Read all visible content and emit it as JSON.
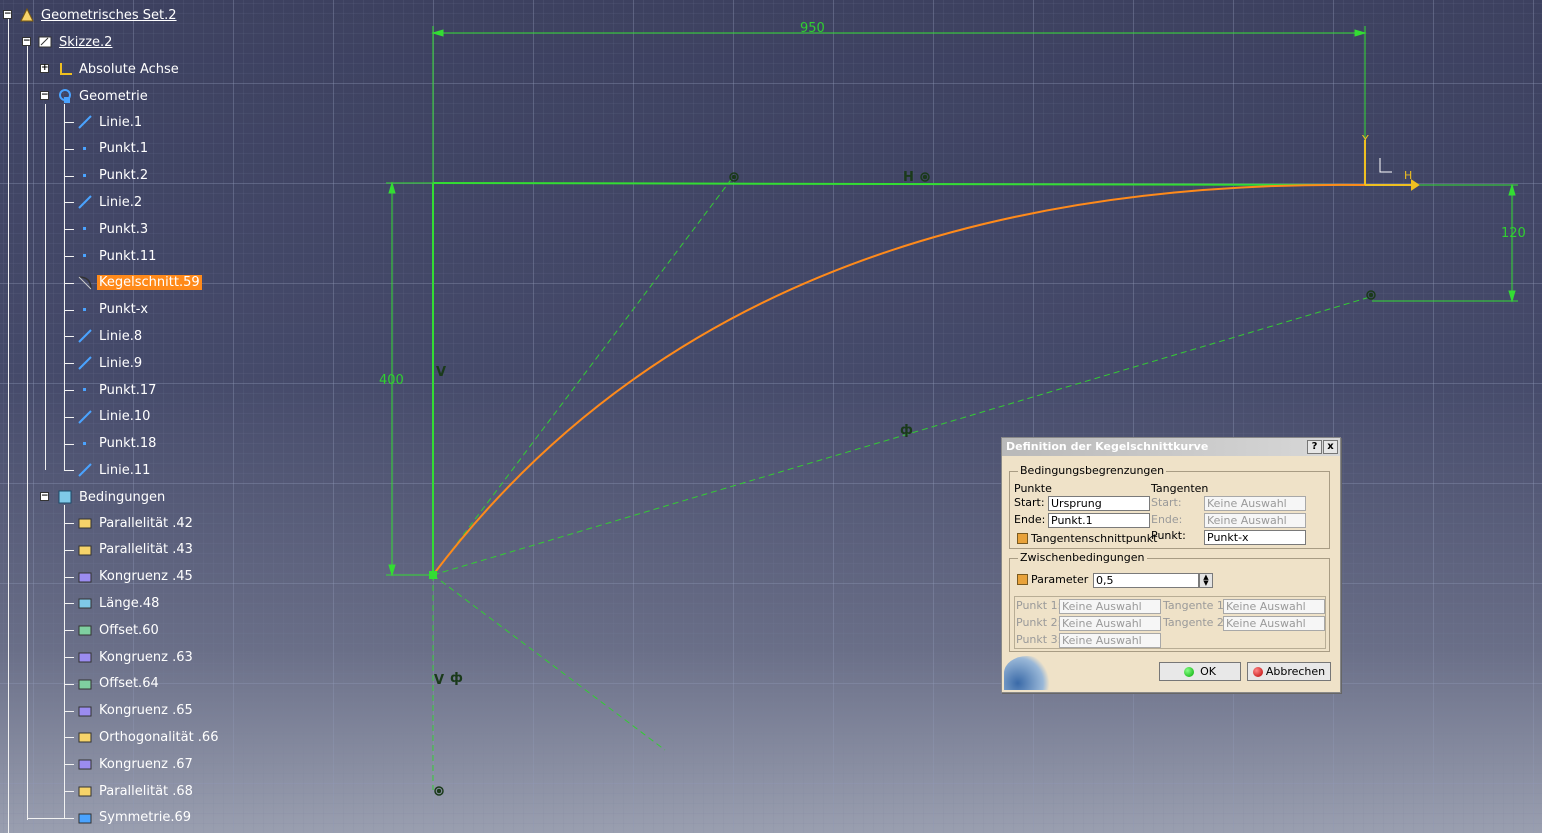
{
  "tree": {
    "root": "Geometrisches Set.2",
    "sketch": "Skizze.2",
    "axis": "Absolute Achse",
    "geometry": "Geometrie",
    "geo_items": [
      "Linie.1",
      "Punkt.1",
      "Punkt.2",
      "Linie.2",
      "Punkt.3",
      "Punkt.11",
      "Kegelschnitt.59",
      "Punkt-x",
      "Linie.8",
      "Linie.9",
      "Punkt.17",
      "Linie.10",
      "Punkt.18",
      "Linie.11"
    ],
    "constraints": "Bedingungen",
    "con_items": [
      "Parallelität .42",
      "Parallelität .43",
      "Kongruenz .45",
      "Länge.48",
      "Offset.60",
      "Kongruenz .63",
      "Offset.64",
      "Kongruenz .65",
      "Orthogonalität .66",
      "Kongruenz .67",
      "Parallelität .68",
      "Symmetrie.69"
    ]
  },
  "sketch": {
    "dim_950": "950",
    "dim_400": "400",
    "dim_120": "120",
    "axis_h": "H",
    "axis_v": "V",
    "c_h": "H",
    "c_v": "V",
    "c_v2": "V",
    "c_y": "Y",
    "c_hh": "H",
    "c_sym": "ф",
    "c_sym2": "ф"
  },
  "dialog": {
    "title": "Definition der Kegelschnittkurve",
    "help": "?",
    "close": "x",
    "group1": "Bedingungsbegrenzungen",
    "punkte": "Punkte",
    "tangenten": "Tangenten",
    "start_label": "Start:",
    "start_value": "Ursprung",
    "ende_label": "Ende:",
    "ende_value": "Punkt.1",
    "t_start_label": "Start:",
    "t_start_value": "Keine Auswahl",
    "t_ende_label": "Ende:",
    "t_ende_value": "Keine Auswahl",
    "tangent_point": "Tangentenschnittpunkt",
    "punkt_label": "Punkt:",
    "punkt_value": "Punkt-x",
    "group2": "Zwischenbedingungen",
    "parameter": "Parameter",
    "parameter_value": "0,5",
    "p1_label": "Punkt 1:",
    "p1_value": "Keine Auswahl",
    "p2_label": "Punkt 2:",
    "p2_value": "Keine Auswahl",
    "p3_label": "Punkt 3:",
    "p3_value": "Keine Auswahl",
    "tg1_label": "Tangente 1:",
    "tg1_value": "Keine Auswahl",
    "tg2_label": "Tangente 2:",
    "tg2_value": "Keine Auswahl",
    "ok": "OK",
    "cancel": "Abbrechen"
  },
  "colors": {
    "sketch_green": "#33dd33",
    "curve_orange": "#ff8a1a",
    "highlight": "#ff8a1a",
    "axis_yellow": "#f0c020"
  }
}
